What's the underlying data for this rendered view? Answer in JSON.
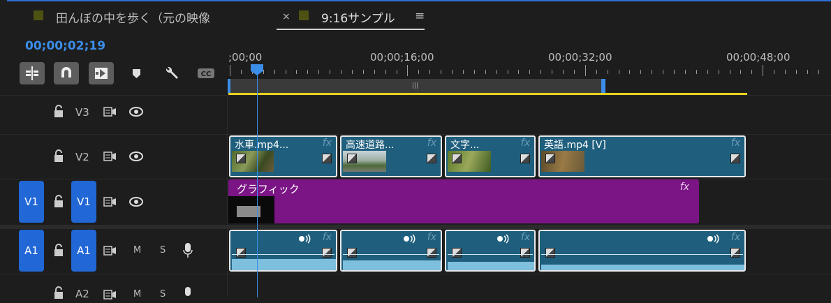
{
  "tabs": [
    {
      "label": "田んぼの中を歩く（元の映像",
      "active": false
    },
    {
      "label": "9:16サンプル",
      "active": true
    }
  ],
  "tab_close_glyph": "×",
  "tab_menu_glyph": "≡",
  "timecode": "00;00;02;19",
  "toolbar": {
    "buttons": [
      "insert-sequence-icon",
      "snap-magnet-icon",
      "linked-selection-icon",
      "marker-icon",
      "wrench-icon",
      "captions-icon"
    ],
    "cc_label": "CC"
  },
  "ruler": {
    "labels": [
      ";00;00",
      "00;00;16;00",
      "00;00;32;00",
      "00;00;48;00"
    ]
  },
  "tracks": {
    "V3": {
      "label": "V3"
    },
    "V2": {
      "label": "V2"
    },
    "V1": {
      "label": "V1",
      "source_label": "V1"
    },
    "A1": {
      "label": "A1",
      "source_label": "A1",
      "m": "M",
      "s": "S"
    },
    "A2": {
      "label": "A2",
      "m": "M",
      "s": "S"
    }
  },
  "clips": {
    "v2": [
      "水車.mp4...",
      "高速道路...",
      "文字...",
      "英語.mp4 [V]"
    ],
    "graphic": "グラフィック",
    "fx": "fx"
  },
  "colors": {
    "accent_blue": "#3b8de8",
    "clip_blue": "#1f5f7d",
    "graphic_purple": "#7b1585",
    "work_area_yellow": "#e8d31c"
  }
}
